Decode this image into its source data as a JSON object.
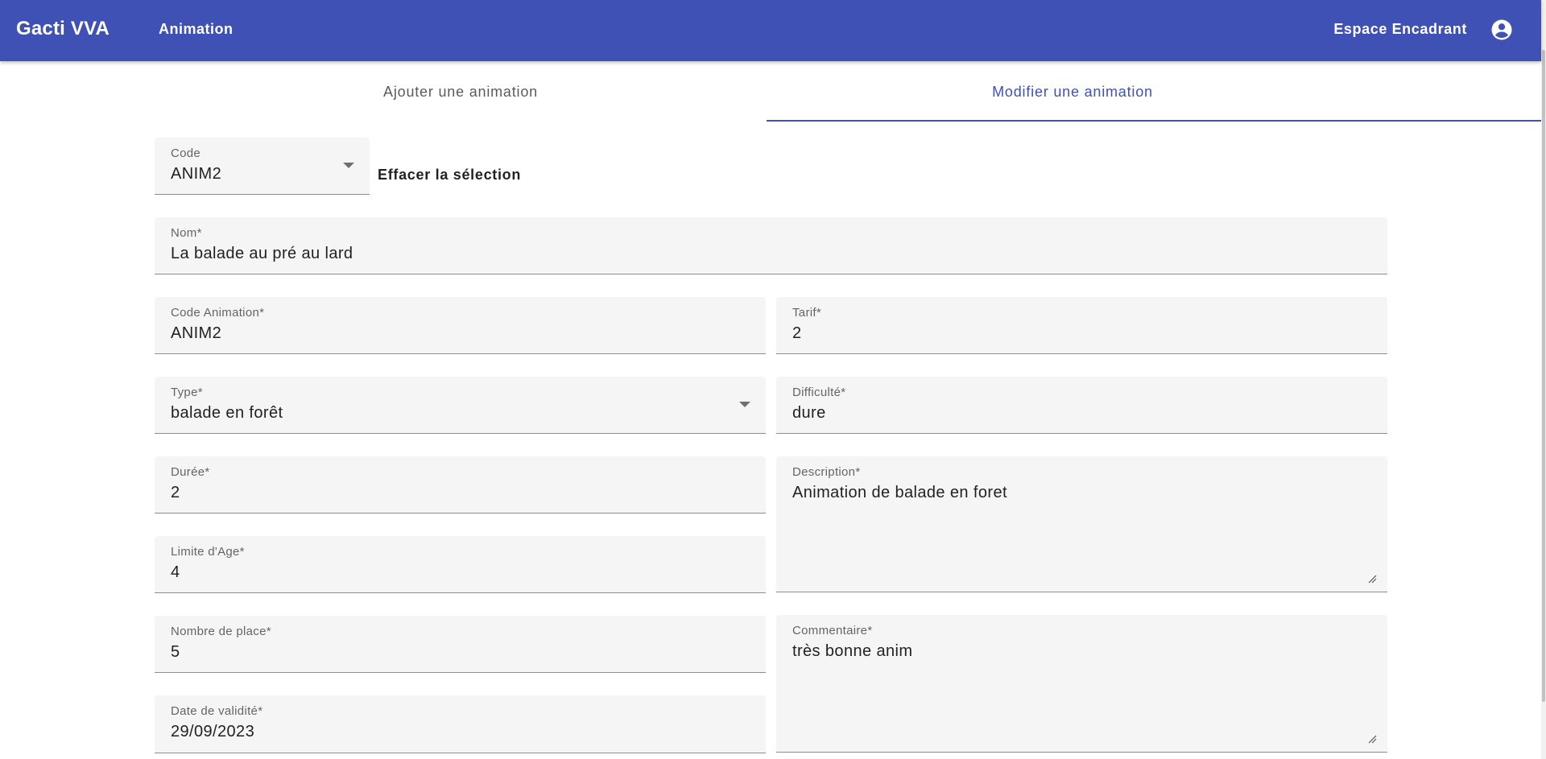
{
  "appbar": {
    "brand": "Gacti VVA",
    "nav_link": "Animation",
    "space_link": "Espace Encadrant",
    "account_icon": "account-circle-icon",
    "color": "#3f51b5"
  },
  "tabs": [
    {
      "label": "Ajouter une animation",
      "active": false
    },
    {
      "label": "Modifier une animation",
      "active": true
    }
  ],
  "code_select": {
    "label": "Code",
    "value": "ANIM2"
  },
  "clear_button": "Effacer la sélection",
  "form": {
    "nom": {
      "label": "Nom*",
      "value": "La balade au pré au lard"
    },
    "code_animation": {
      "label": "Code Animation*",
      "value": "ANIM2"
    },
    "tarif": {
      "label": "Tarif*",
      "value": "2"
    },
    "type": {
      "label": "Type*",
      "value": "balade en forêt"
    },
    "difficulte": {
      "label": "Difficulté*",
      "value": "dure"
    },
    "duree": {
      "label": "Durée*",
      "value": "2"
    },
    "description": {
      "label": "Description*",
      "value": "Animation de balade en foret"
    },
    "limite_age": {
      "label": "Limite d'Age*",
      "value": "4"
    },
    "nombre_place": {
      "label": "Nombre de place*",
      "value": "5"
    },
    "commentaire": {
      "label": "Commentaire*",
      "value": "très bonne anim"
    },
    "date_validite": {
      "label": "Date de validité*",
      "value": "29/09/2023"
    }
  }
}
